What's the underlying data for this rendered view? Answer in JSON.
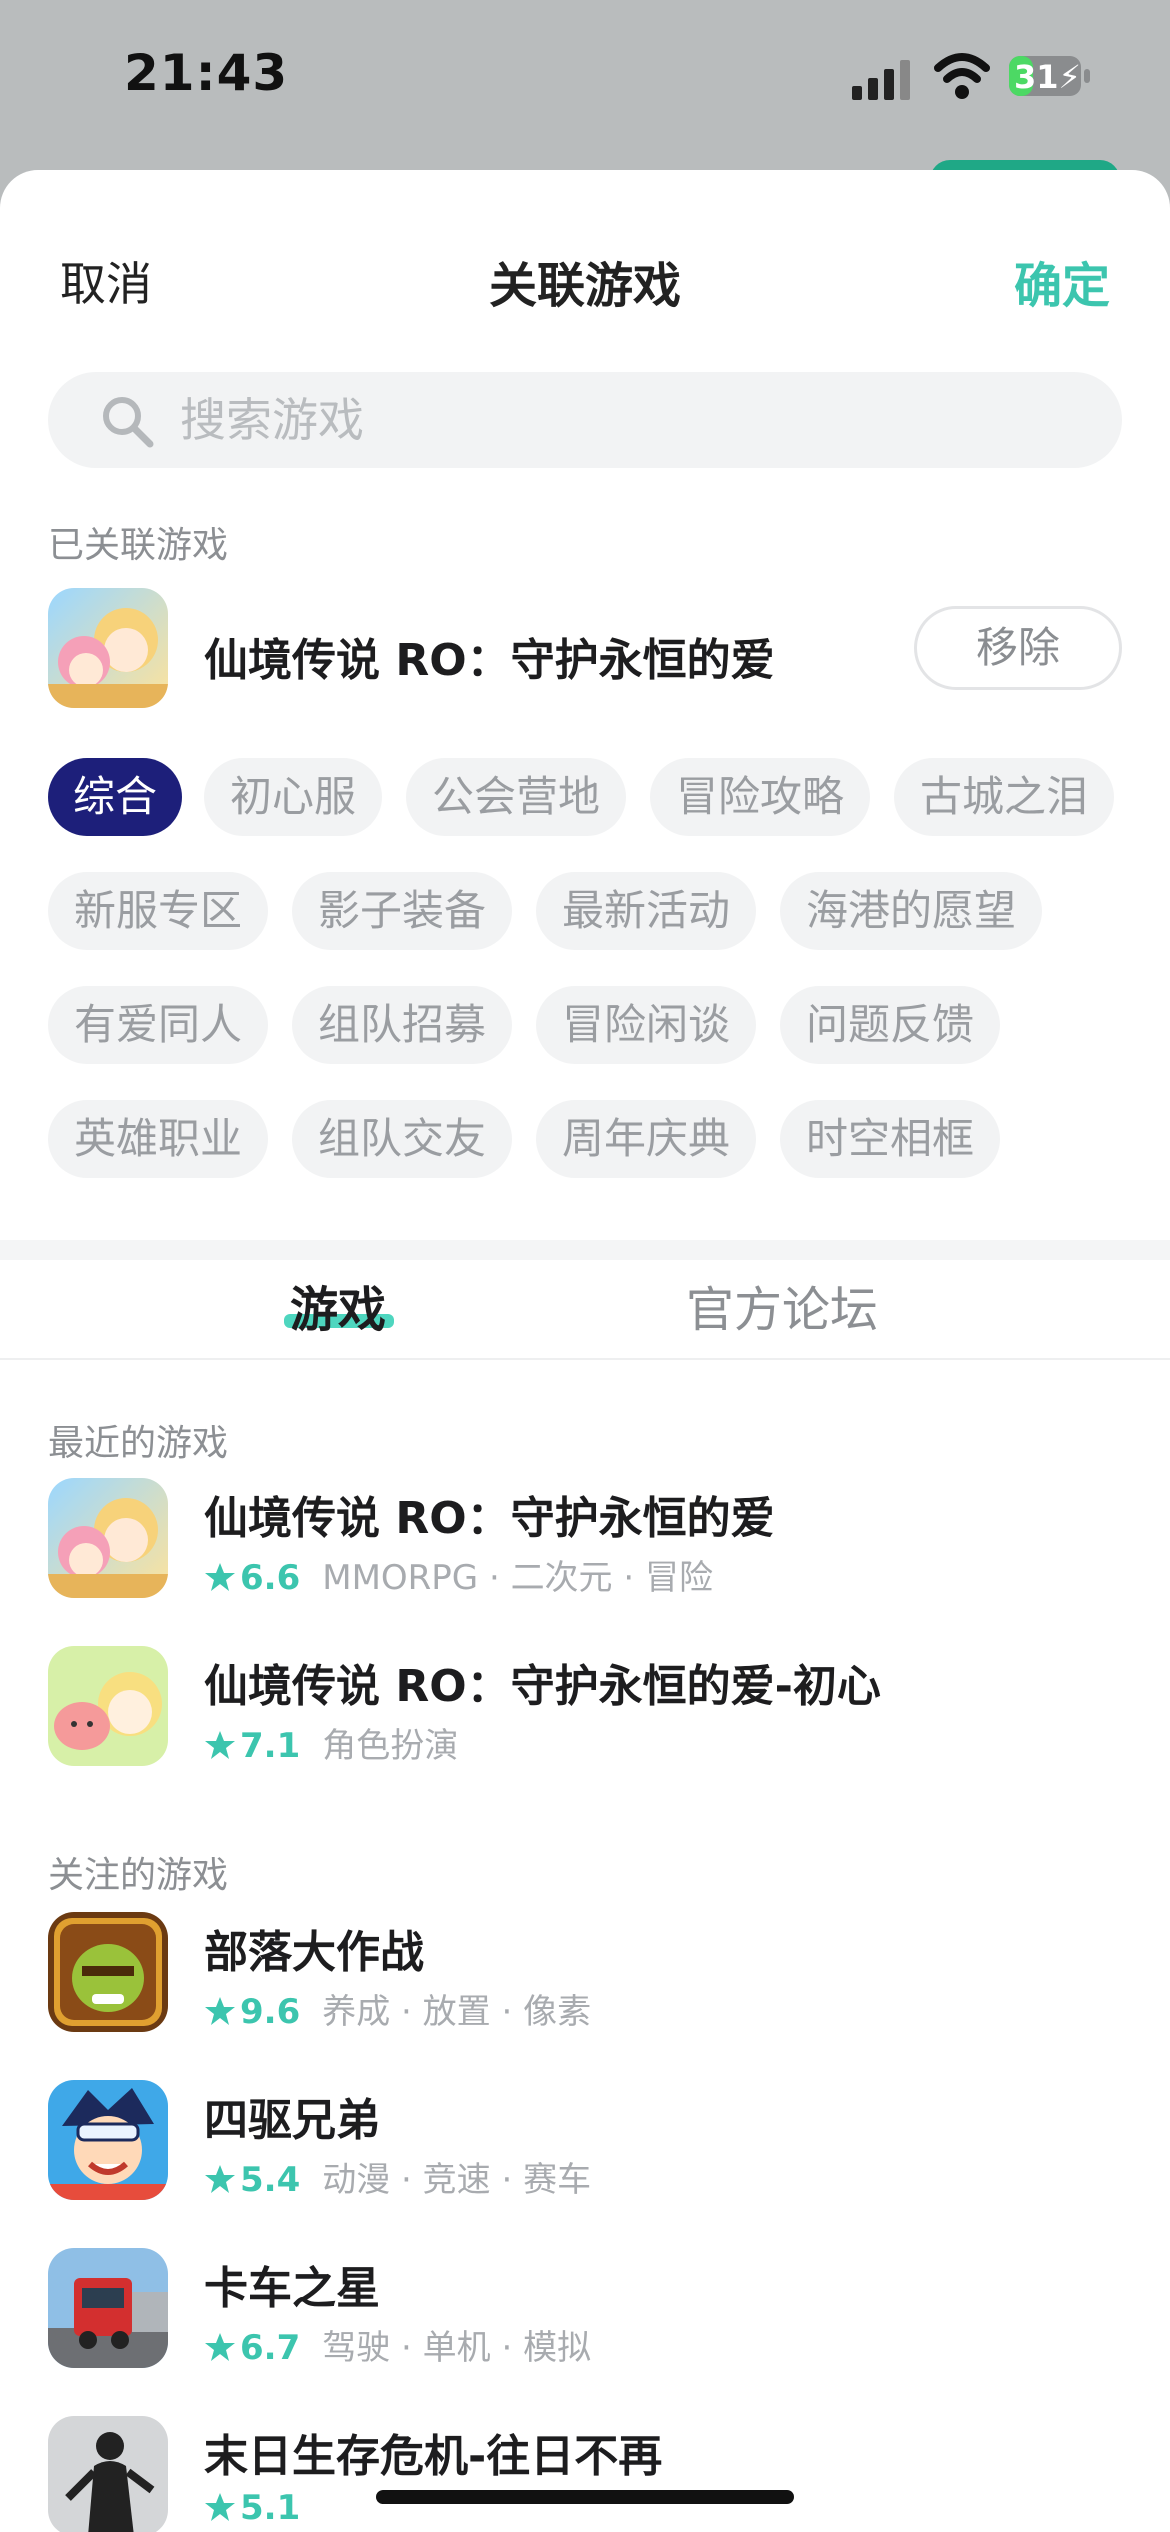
{
  "status": {
    "time": "21:43",
    "battery": "31"
  },
  "nav": {
    "cancel": "取消",
    "title": "关联游戏",
    "confirm": "确定"
  },
  "search": {
    "placeholder": "搜索游戏"
  },
  "linked": {
    "label": "已关联游戏",
    "game": {
      "name": "仙境传说 RO：守护永恒的爱",
      "icon": "ro-anime-girls-icon"
    },
    "remove": "移除"
  },
  "tags": [
    "综合",
    "初心服",
    "公会营地",
    "冒险攻略",
    "古城之泪",
    "新服专区",
    "影子装备",
    "最新活动",
    "海港的愿望",
    "有爱同人",
    "组队招募",
    "冒险闲谈",
    "问题反馈",
    "英雄职业",
    "组队交友",
    "周年庆典",
    "时空相框"
  ],
  "active_tag": "综合",
  "tabs": {
    "games": "游戏",
    "forum": "官方论坛",
    "selected": "游戏"
  },
  "recent": {
    "label": "最近的游戏",
    "games": [
      {
        "name": "仙境传说 RO：守护永恒的爱",
        "rating": "6.6",
        "tags": "MMORPG · 二次元 · 冒险",
        "icon": "ro-anime-girls-icon"
      },
      {
        "name": "仙境传说 RO：守护永恒的爱-初心",
        "rating": "7.1",
        "tags": "角色扮演",
        "icon": "ro-chibi-icon"
      }
    ]
  },
  "followed": {
    "label": "关注的游戏",
    "games": [
      {
        "name": "部落大作战",
        "rating": "9.6",
        "tags": "养成 · 放置 · 像素",
        "icon": "orc-warrior-icon"
      },
      {
        "name": "四驱兄弟",
        "rating": "5.4",
        "tags": "动漫 · 竞速 · 赛车",
        "icon": "racer-boy-icon"
      },
      {
        "name": "卡车之星",
        "rating": "6.7",
        "tags": "驾驶 · 单机 · 模拟",
        "icon": "red-truck-icon"
      },
      {
        "name": "末日生存危机-往日不再",
        "rating": "5.1",
        "tags": "",
        "icon": "zombie-silhouette-icon"
      }
    ]
  },
  "colors": {
    "accent": "#3cc5ae",
    "active_tag": "#1d1f7a",
    "tag_bg": "#f2f3f4",
    "meta_text": "#a8abaf"
  }
}
